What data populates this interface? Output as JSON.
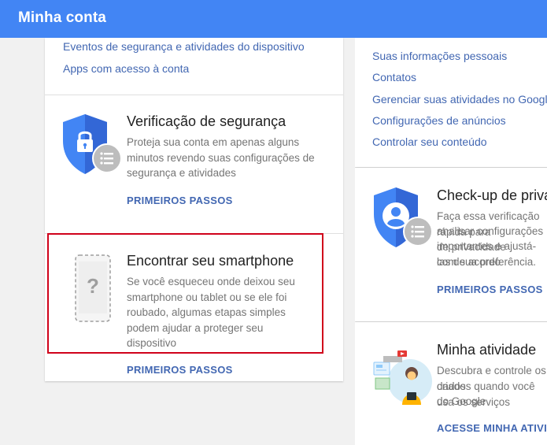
{
  "header": {
    "title": "Minha conta"
  },
  "left": {
    "links": [
      "Eventos de segurança e atividades do dispositivo",
      "Apps com acesso à conta"
    ],
    "security_check": {
      "title": "Verificação de segurança",
      "description": "Proteja sua conta em apenas alguns minutos revendo suas configurações de segurança e atividades",
      "cta": "PRIMEIROS PASSOS"
    },
    "find_phone": {
      "title": "Encontrar seu smartphone",
      "description": "Se você esqueceu onde deixou seu smartphone ou tablet ou se ele foi roubado, algumas etapas simples podem ajudar a proteger seu dispositivo",
      "cta": "PRIMEIROS PASSOS"
    }
  },
  "right": {
    "links": [
      "Suas informações pessoais",
      "Contatos",
      "Gerenciar suas atividades no Google",
      "Configurações de anúncios",
      "Controlar seu conteúdo"
    ],
    "privacy_check": {
      "title": "Check-up de privacidade",
      "lines": [
        "Faça essa verificação rápida para",
        "analisar configurações de privacidade",
        "importantes e ajustá-las de acordo",
        "com sua preferência."
      ],
      "cta": "PRIMEIROS PASSOS"
    },
    "my_activity": {
      "title": "Minha atividade",
      "lines": [
        "Descubra e controle os dados",
        "criados quando você usa os serviços",
        "do Google"
      ],
      "cta": "ACESSE MINHA ATIVIDADE"
    }
  },
  "colors": {
    "header": "#4285f4",
    "shield": "#4285f4",
    "highlight": "#d0021b",
    "link": "#4267b2"
  }
}
